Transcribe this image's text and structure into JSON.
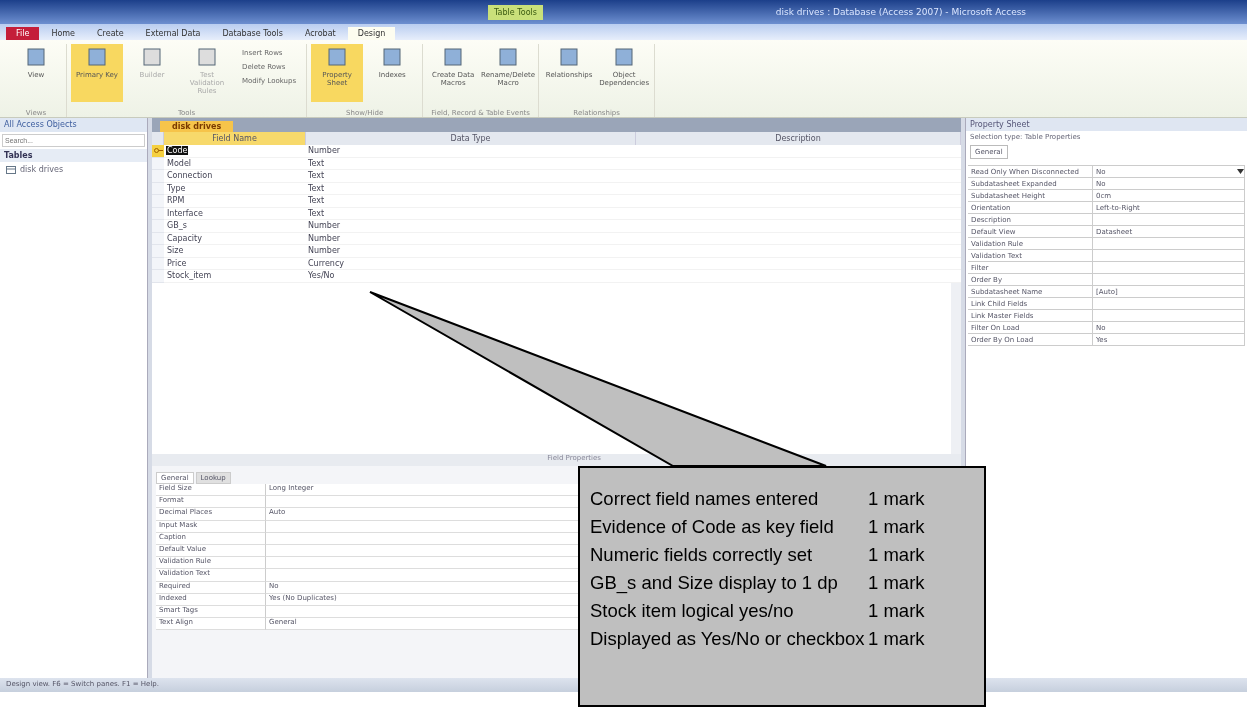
{
  "window": {
    "title": "disk drives : Database (Access 2007) - Microsoft Access",
    "context_tab": "Table Tools"
  },
  "ribbon_tabs": [
    {
      "label": "File",
      "selected": false,
      "kind": "file"
    },
    {
      "label": "Home",
      "selected": false,
      "kind": "tab"
    },
    {
      "label": "Create",
      "selected": false,
      "kind": "tab"
    },
    {
      "label": "External Data",
      "selected": false,
      "kind": "tab"
    },
    {
      "label": "Database Tools",
      "selected": false,
      "kind": "tab"
    },
    {
      "label": "Acrobat",
      "selected": false,
      "kind": "tab"
    },
    {
      "label": "Design",
      "selected": true,
      "kind": "tab"
    }
  ],
  "ribbon_groups": [
    {
      "name": "Views",
      "buttons": [
        {
          "label": "View",
          "selected": false,
          "disabled": false
        }
      ]
    },
    {
      "name": "Tools",
      "buttons": [
        {
          "label": "Primary Key",
          "selected": true,
          "disabled": false
        },
        {
          "label": "Builder",
          "selected": false,
          "disabled": true
        },
        {
          "label": "Test Validation Rules",
          "selected": false,
          "disabled": true
        }
      ],
      "small_buttons": [
        "Insert Rows",
        "Delete Rows",
        "Modify Lookups"
      ]
    },
    {
      "name": "Show/Hide",
      "buttons": [
        {
          "label": "Property Sheet",
          "selected": true,
          "disabled": false
        },
        {
          "label": "Indexes",
          "selected": false,
          "disabled": false
        }
      ]
    },
    {
      "name": "Field, Record & Table Events",
      "buttons": [
        {
          "label": "Create Data Macros",
          "selected": false,
          "disabled": false
        },
        {
          "label": "Rename/Delete Macro",
          "selected": false,
          "disabled": false
        }
      ]
    },
    {
      "name": "Relationships",
      "buttons": [
        {
          "label": "Relationships",
          "selected": false,
          "disabled": false
        },
        {
          "label": "Object Dependencies",
          "selected": false,
          "disabled": false
        }
      ]
    }
  ],
  "navigation": {
    "title": "All Access Objects",
    "search_placeholder": "Search...",
    "section": "Tables",
    "items": [
      "disk drives"
    ]
  },
  "document": {
    "tab": "disk drives",
    "columns": [
      "Field Name",
      "Data Type",
      "Description"
    ],
    "rows": [
      {
        "name": "Code",
        "type": "Number",
        "key": true,
        "selected": true
      },
      {
        "name": "Model",
        "type": "Text",
        "key": false,
        "selected": false
      },
      {
        "name": "Connection",
        "type": "Text",
        "key": false,
        "selected": false
      },
      {
        "name": "Type",
        "type": "Text",
        "key": false,
        "selected": false
      },
      {
        "name": "RPM",
        "type": "Text",
        "key": false,
        "selected": false
      },
      {
        "name": "Interface",
        "type": "Text",
        "key": false,
        "selected": false
      },
      {
        "name": "GB_s",
        "type": "Number",
        "key": false,
        "selected": false
      },
      {
        "name": "Capacity",
        "type": "Number",
        "key": false,
        "selected": false
      },
      {
        "name": "Size",
        "type": "Number",
        "key": false,
        "selected": false
      },
      {
        "name": "Price",
        "type": "Currency",
        "key": false,
        "selected": false
      },
      {
        "name": "Stock_item",
        "type": "Yes/No",
        "key": false,
        "selected": false
      }
    ],
    "field_properties_label": "Field Properties",
    "property_tabs": [
      {
        "label": "General",
        "selected": true
      },
      {
        "label": "Lookup",
        "selected": false
      }
    ],
    "properties": [
      {
        "name": "Field Size",
        "value": "Long Integer"
      },
      {
        "name": "Format"
      },
      {
        "name": "Decimal Places",
        "value": "Auto"
      },
      {
        "name": "Input Mask"
      },
      {
        "name": "Caption"
      },
      {
        "name": "Default Value"
      },
      {
        "name": "Validation Rule"
      },
      {
        "name": "Validation Text"
      },
      {
        "name": "Required",
        "value": "No"
      },
      {
        "name": "Indexed",
        "value": "Yes (No Duplicates)"
      },
      {
        "name": "Smart Tags"
      },
      {
        "name": "Text Align",
        "value": "General"
      }
    ]
  },
  "property_sheet": {
    "title": "Property Sheet",
    "selection_type": "Selection type: Table Properties",
    "tab": "General",
    "rows": [
      {
        "name": "Read Only When Disconnected",
        "value": "No",
        "kind": "dropdown"
      },
      {
        "name": "Subdatasheet Expanded",
        "value": "No",
        "kind": "plain"
      },
      {
        "name": "Subdatasheet Height",
        "value": "0cm",
        "kind": "plain"
      },
      {
        "name": "Orientation",
        "value": "Left-to-Right",
        "kind": "plain"
      },
      {
        "name": "Description",
        "kind": "plain"
      },
      {
        "name": "Default View",
        "value": "Datasheet",
        "kind": "plain"
      },
      {
        "name": "Validation Rule",
        "kind": "plain"
      },
      {
        "name": "Validation Text",
        "kind": "plain"
      },
      {
        "name": "Filter",
        "kind": "plain"
      },
      {
        "name": "Order By",
        "kind": "plain"
      },
      {
        "name": "Subdatasheet Name",
        "value": "[Auto]",
        "kind": "plain"
      },
      {
        "name": "Link Child Fields",
        "kind": "plain"
      },
      {
        "name": "Link Master Fields",
        "kind": "plain"
      },
      {
        "name": "Filter On Load",
        "value": "No",
        "kind": "plain"
      },
      {
        "name": "Order By On Load",
        "value": "Yes",
        "kind": "plain"
      }
    ]
  },
  "status_bar": "Design view.  F6 = Switch panes.  F1 = Help.",
  "callout": {
    "items": [
      {
        "criterion": "Correct field names entered",
        "mark": "1 mark"
      },
      {
        "criterion": "Evidence of Code as key field",
        "mark": "1 mark"
      },
      {
        "criterion": "Numeric fields correctly set",
        "mark": "1 mark"
      },
      {
        "criterion": "GB_s and Size display to 1 dp",
        "mark": "1 mark"
      },
      {
        "criterion": "Stock item logical yes/no",
        "mark": "1 mark"
      },
      {
        "criterion": "Displayed as Yes/No or checkbox",
        "mark": "1 mark"
      }
    ]
  }
}
